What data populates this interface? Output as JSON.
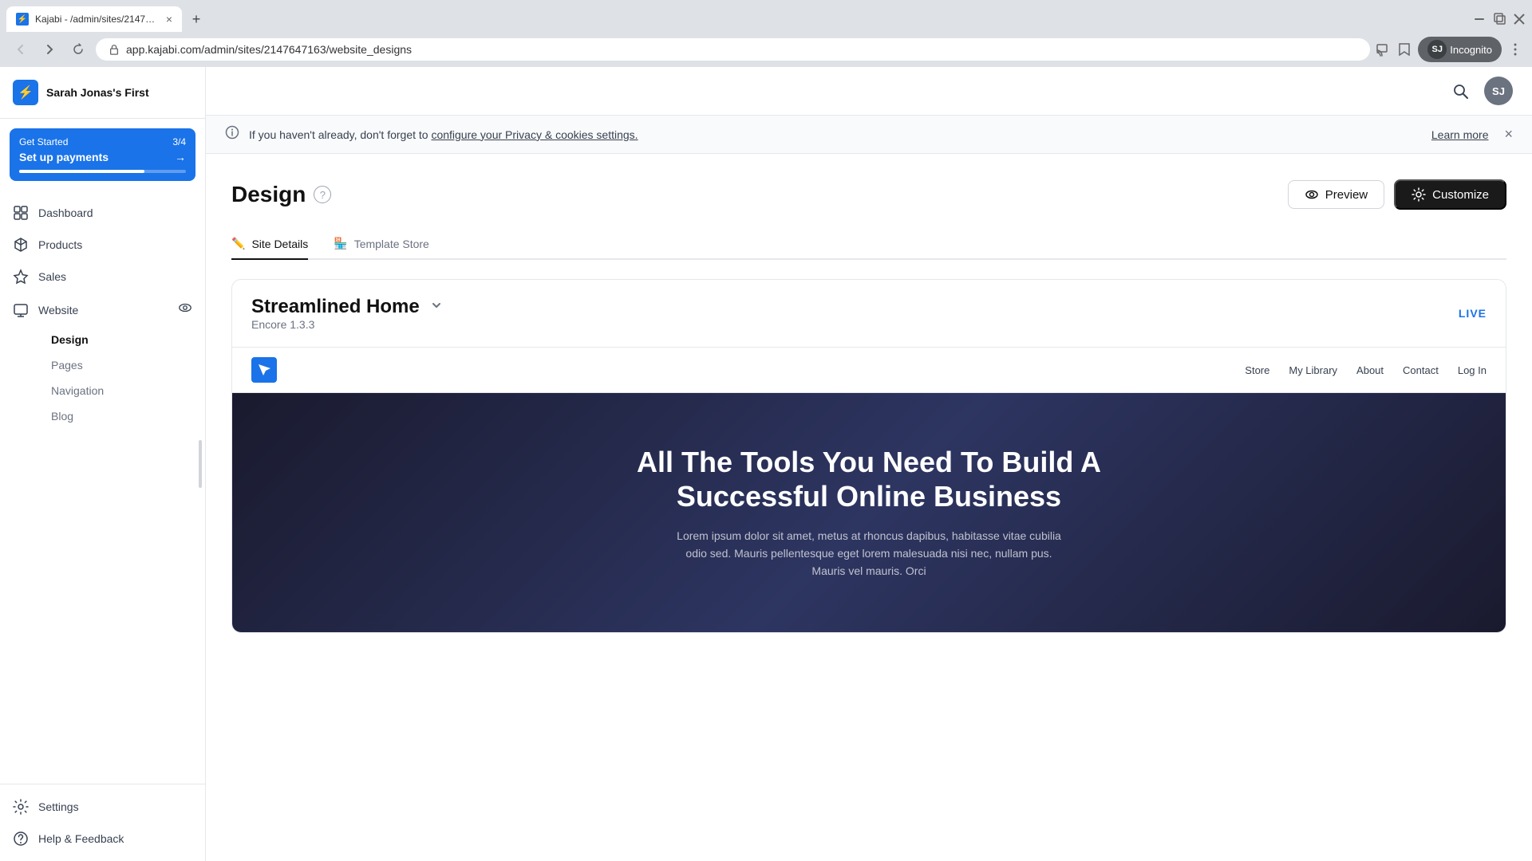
{
  "browser": {
    "tab_title": "Kajabi - /admin/sites/214764716...",
    "tab_close": "×",
    "new_tab": "+",
    "url": "app.kajabi.com/admin/sites/2147647163/website_designs",
    "incognito_label": "Incognito",
    "user_initials": "SJ"
  },
  "notification": {
    "text": "If you haven't already, don't forget to ",
    "link_text": "configure your Privacy & cookies settings.",
    "learn_more": "Learn more",
    "close": "×"
  },
  "sidebar": {
    "site_name": "Sarah Jonas's First",
    "get_started": {
      "label": "Get Started",
      "count": "3/4",
      "cta": "Set up payments",
      "arrow": "→"
    },
    "nav_items": [
      {
        "id": "dashboard",
        "label": "Dashboard",
        "icon": "🏠"
      },
      {
        "id": "products",
        "label": "Products",
        "icon": "🛍️"
      },
      {
        "id": "sales",
        "label": "Sales",
        "icon": "💎"
      },
      {
        "id": "website",
        "label": "Website",
        "icon": "🖥️",
        "has_sub": true
      }
    ],
    "website_sub": [
      {
        "id": "design",
        "label": "Design",
        "active": true
      },
      {
        "id": "pages",
        "label": "Pages"
      },
      {
        "id": "navigation",
        "label": "Navigation"
      },
      {
        "id": "blog",
        "label": "Blog"
      }
    ],
    "bottom_items": [
      {
        "id": "settings",
        "label": "Settings",
        "icon": "⚙️"
      },
      {
        "id": "help",
        "label": "Help & Feedback",
        "icon": "❓"
      }
    ]
  },
  "page": {
    "title": "Design",
    "help_icon": "?",
    "preview_button": "Preview",
    "customize_button": "Customize",
    "tabs": [
      {
        "id": "site-details",
        "label": "Site Details",
        "icon": "✏️"
      },
      {
        "id": "template-store",
        "label": "Template Store",
        "icon": "🏪"
      }
    ],
    "template": {
      "name": "Streamlined Home",
      "version": "Encore 1.3.3",
      "status": "LIVE"
    },
    "preview": {
      "nav_links": [
        "Store",
        "My Library",
        "About",
        "Contact",
        "Log In"
      ],
      "hero_title": "All The Tools You Need To Build A Successful Online Business",
      "hero_text": "Lorem ipsum dolor sit amet, metus at rhoncus dapibus, habitasse vitae cubilia odio sed. Mauris pellentesque eget lorem malesuada nisi nec, nullam pus. Mauris vel mauris. Orci"
    }
  }
}
